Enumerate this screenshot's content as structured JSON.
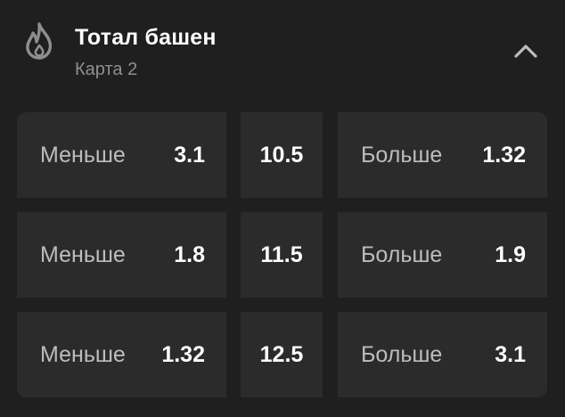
{
  "header": {
    "title": "Тотал башен",
    "subtitle": "Карта 2",
    "icon": "fire-icon",
    "collapse_icon": "chevron-up-icon"
  },
  "markets": [
    {
      "under_label": "Меньше",
      "under_odds": "3.1",
      "total": "10.5",
      "over_label": "Больше",
      "over_odds": "1.32"
    },
    {
      "under_label": "Меньше",
      "under_odds": "1.8",
      "total": "11.5",
      "over_label": "Больше",
      "over_odds": "1.9"
    },
    {
      "under_label": "Меньше",
      "under_odds": "1.32",
      "total": "12.5",
      "over_label": "Больше",
      "over_odds": "3.1"
    }
  ],
  "colors": {
    "background": "#1f1f1f",
    "cell": "#2b2b2b",
    "label": "#bdbdbd",
    "muted": "#8f8f8f",
    "text": "#ffffff"
  }
}
